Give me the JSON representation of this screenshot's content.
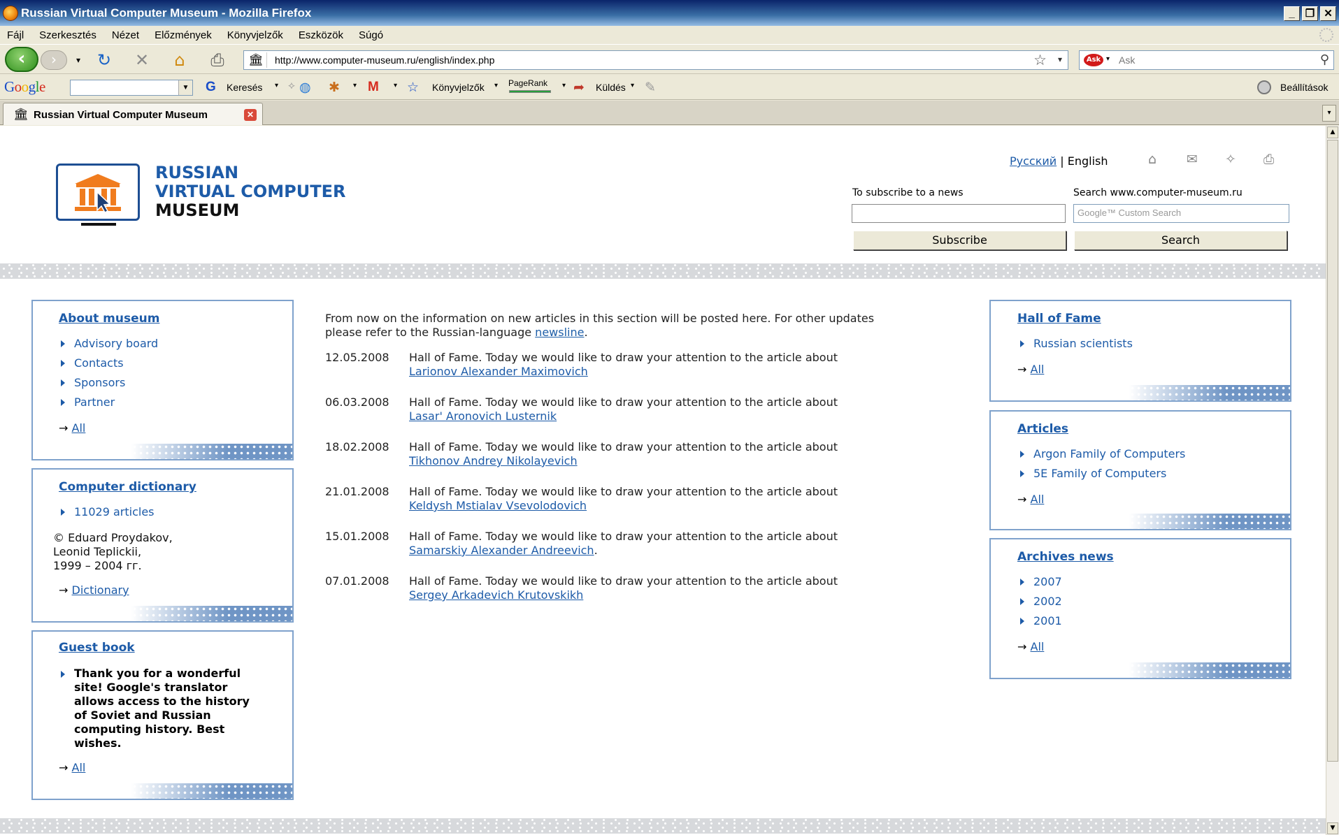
{
  "window": {
    "title": "Russian Virtual Computer Museum - Mozilla Firefox",
    "buttons": [
      "_",
      "❐",
      "✕"
    ]
  },
  "menu": [
    "Fájl",
    "Szerkesztés",
    "Nézet",
    "Előzmények",
    "Könyvjelzők",
    "Eszközök",
    "Súgó"
  ],
  "navbar": {
    "url": "http://www.computer-museum.ru/english/index.php",
    "search_placeholder": "Ask",
    "search_engine": "Ask"
  },
  "google_toolbar": {
    "logo": [
      "G",
      "o",
      "o",
      "g",
      "l",
      "e"
    ],
    "search_label": "Keresés",
    "bookmarks_label": "Könyvjelzők",
    "pagerank_label": "PageRank",
    "send_label": "Küldés",
    "settings_label": "Beállítások"
  },
  "tab": {
    "label": "Russian Virtual Computer Museum"
  },
  "site": {
    "logo": {
      "line1": "RUSSIAN",
      "line2": "VIRTUAL COMPUTER",
      "line3": "MUSEUM"
    },
    "lang": {
      "russian": "Русский",
      "separator": "|",
      "english": "English"
    },
    "subscribe": {
      "label": "To subscribe to a news",
      "button": "Subscribe"
    },
    "search": {
      "label": "Search www.computer-museum.ru",
      "placeholder": "Google™ Custom Search",
      "button": "Search"
    }
  },
  "left": {
    "about": {
      "title": "About museum",
      "items": [
        "Advisory board",
        "Contacts",
        "Sponsors",
        "Partner"
      ],
      "all": "All"
    },
    "dictionary": {
      "title": "Computer dictionary",
      "items": [
        "11029 articles"
      ],
      "credit1": "© Eduard Proydakov,",
      "credit2": "Leonid Teplickii,",
      "credit3": "1999 – 2004 гг.",
      "link": "Dictionary"
    },
    "guestbook": {
      "title": "Guest book",
      "quote_lines": [
        "Thank you for a wonderful",
        "site! Google's translator",
        "allows access to the history",
        "of Soviet and Russian",
        "computing history. Best",
        "wishes."
      ],
      "all": "All"
    }
  },
  "main": {
    "intro_1": "From now on the information on new articles in this section will be posted here. For other updates please refer to the Russian-language ",
    "intro_link": "newsline",
    "intro_end": ".",
    "news": [
      {
        "date": "12.05.2008",
        "text": "Hall of Fame. Today we would like to draw your attention to the article about",
        "link": "Larionov Alexander Maximovich",
        "suffix": ""
      },
      {
        "date": "06.03.2008",
        "text": "Hall of Fame. Today we would like to draw your attention to the article about",
        "link": "Lasar' Aronovich Lusternik",
        "suffix": ""
      },
      {
        "date": "18.02.2008",
        "text": "Hall of Fame. Today we would like to draw your attention to the article about",
        "link": "Tikhonov Andrey Nikolayevich",
        "suffix": ""
      },
      {
        "date": "21.01.2008",
        "text": "Hall of Fame. Today we would like to draw your attention to the article about",
        "link": "Keldysh Mstialav Vsevolodovich",
        "suffix": ""
      },
      {
        "date": "15.01.2008",
        "text": "Hall of Fame. Today we would like to draw your attention to the article about",
        "link": "Samarskiy Alexander Andreevich",
        "suffix": "."
      },
      {
        "date": "07.01.2008",
        "text": "Hall of Fame. Today we would like to draw your attention to the article about",
        "link": "Sergey Arkadevich Krutovskikh",
        "suffix": ""
      }
    ]
  },
  "right": {
    "hall": {
      "title": "Hall of Fame",
      "items": [
        "Russian scientists"
      ],
      "all": "All"
    },
    "articles": {
      "title": "Articles",
      "items": [
        "Argon Family of Computers",
        "5E Family of Computers"
      ],
      "all": "All"
    },
    "archives": {
      "title": "Archives news",
      "items": [
        "2007",
        "2002",
        "2001"
      ],
      "all": "All"
    }
  },
  "arrow": "→"
}
